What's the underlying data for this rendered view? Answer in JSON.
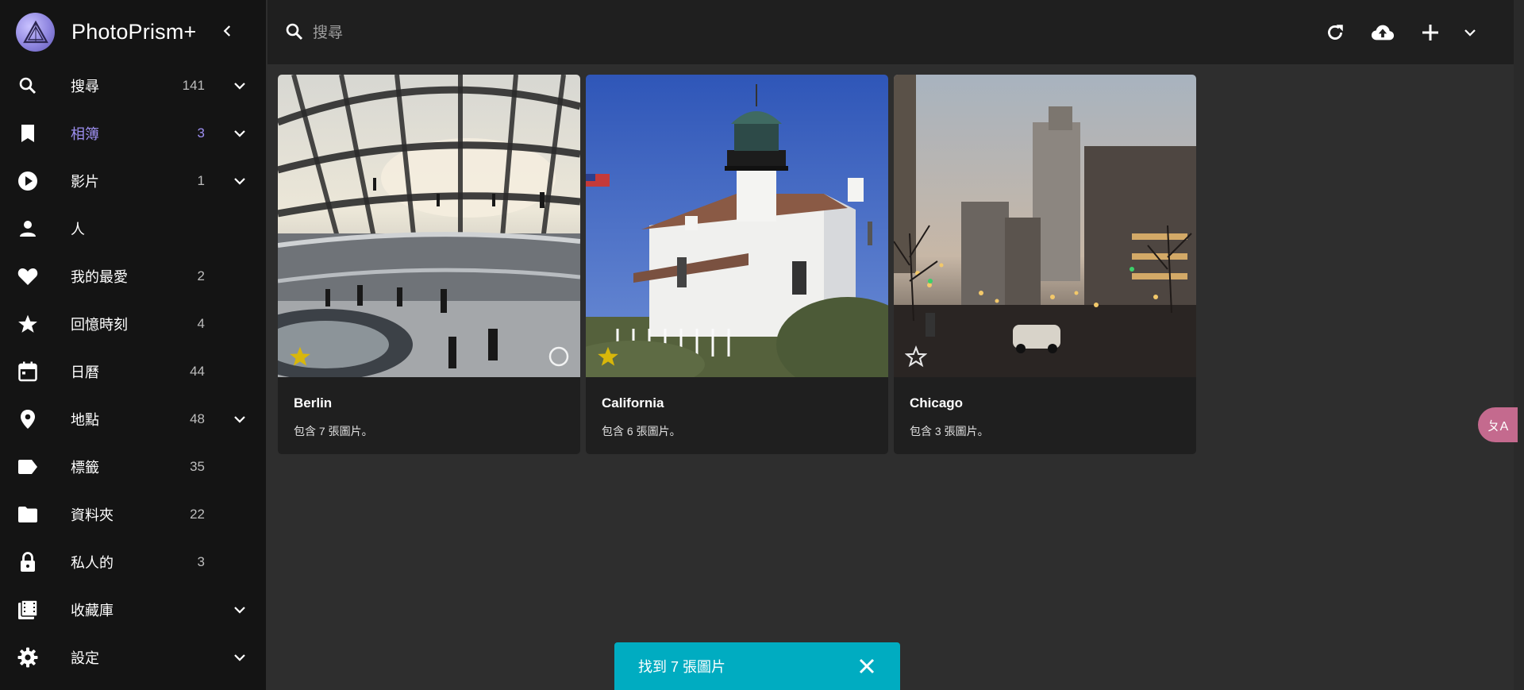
{
  "app": {
    "name": "PhotoPrism+"
  },
  "sidebar": {
    "items": [
      {
        "label": "搜尋",
        "count": "141",
        "icon": "search-icon",
        "expandable": true
      },
      {
        "label": "相簿",
        "count": "3",
        "icon": "bookmark-icon",
        "expandable": true,
        "active": true
      },
      {
        "label": "影片",
        "count": "1",
        "icon": "play-circle-icon",
        "expandable": true
      },
      {
        "label": "人",
        "count": "",
        "icon": "person-icon",
        "expandable": false
      },
      {
        "label": "我的最愛",
        "count": "2",
        "icon": "heart-icon",
        "expandable": false
      },
      {
        "label": "回憶時刻",
        "count": "4",
        "icon": "star-icon",
        "expandable": false
      },
      {
        "label": "日曆",
        "count": "44",
        "icon": "calendar-icon",
        "expandable": false
      },
      {
        "label": "地點",
        "count": "48",
        "icon": "map-pin-icon",
        "expandable": true
      },
      {
        "label": "標籤",
        "count": "35",
        "icon": "tag-icon",
        "expandable": false
      },
      {
        "label": "資料夾",
        "count": "22",
        "icon": "folder-icon",
        "expandable": false
      },
      {
        "label": "私人的",
        "count": "3",
        "icon": "lock-icon",
        "expandable": false
      },
      {
        "label": "收藏庫",
        "count": "",
        "icon": "film-library-icon",
        "expandable": true
      },
      {
        "label": "設定",
        "count": "",
        "icon": "gear-icon",
        "expandable": true
      }
    ]
  },
  "search": {
    "placeholder": "搜尋",
    "value": ""
  },
  "albums": [
    {
      "title": "Berlin",
      "desc": "包含 7 張圖片。",
      "favorite": true
    },
    {
      "title": "California",
      "desc": "包含 6 張圖片。",
      "favorite": true
    },
    {
      "title": "Chicago",
      "desc": "包含 3 張圖片。",
      "favorite": false
    }
  ],
  "snackbar": {
    "text": "找到 7 張圖片"
  },
  "translate_tab": {
    "label": "ㄆA"
  },
  "colors": {
    "accent": "#9d8ff0",
    "snackbar": "#00acc1",
    "star": "#d8b70a",
    "sidebar_bg": "#141414",
    "content_bg": "#2e2e2e"
  }
}
